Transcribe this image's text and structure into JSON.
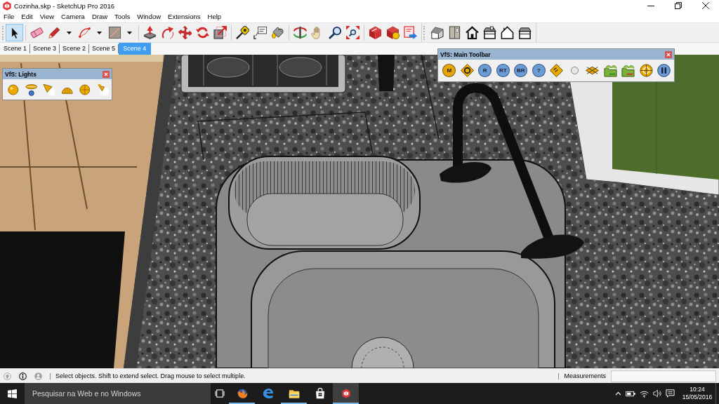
{
  "window": {
    "title": "Cozinha.skp - SketchUp Pro 2016"
  },
  "menu": [
    "File",
    "Edit",
    "View",
    "Camera",
    "Draw",
    "Tools",
    "Window",
    "Extensions",
    "Help"
  ],
  "toolbars": [
    {
      "groups": [
        [
          {
            "selected": true,
            "dropdown": false
          }
        ],
        [
          {
            "selected": false,
            "dropdown": false
          },
          {
            "selected": false,
            "dropdown": true
          },
          {
            "selected": false,
            "dropdown": true
          },
          {
            "selected": false,
            "dropdown": true
          }
        ],
        [
          {
            "selected": false,
            "dropdown": false
          },
          {
            "selected": false,
            "dropdown": false
          },
          {
            "selected": false,
            "dropdown": false
          },
          {
            "selected": false,
            "dropdown": false
          },
          {
            "selected": false,
            "dropdown": false
          }
        ],
        [
          {
            "selected": false,
            "dropdown": false
          },
          {
            "selected": false,
            "dropdown": false
          },
          {
            "selected": false,
            "dropdown": false
          }
        ],
        [
          {
            "selected": false,
            "dropdown": false
          },
          {
            "selected": false,
            "dropdown": false
          },
          {
            "selected": false,
            "dropdown": false
          },
          {
            "selected": false,
            "dropdown": false
          }
        ],
        [
          {
            "selected": false,
            "dropdown": false
          },
          {
            "selected": false,
            "dropdown": false
          },
          {
            "selected": false,
            "dropdown": false
          }
        ]
      ]
    },
    {
      "groups": [
        [
          {
            "selected": false,
            "dropdown": false
          },
          {
            "selected": false,
            "dropdown": false
          },
          {
            "selected": false,
            "dropdown": false
          },
          {
            "selected": false,
            "dropdown": false
          },
          {
            "selected": false,
            "dropdown": false
          },
          {
            "selected": false,
            "dropdown": false
          }
        ]
      ]
    }
  ],
  "scenes": [
    {
      "label": "Scene 1",
      "selected": false
    },
    {
      "label": "Scene 3",
      "selected": false
    },
    {
      "label": "Scene 2",
      "selected": false
    },
    {
      "label": "Scene 5",
      "selected": false
    },
    {
      "label": "Scene 4",
      "selected": true
    }
  ],
  "floating_toolbars": [
    {
      "title": "VfS: Lights",
      "kind": "lights",
      "buttons": [
        {
          "kind": "glyph"
        },
        {
          "kind": "glyph"
        },
        {
          "kind": "glyph"
        },
        {
          "kind": "glyph"
        },
        {
          "kind": "glyph"
        },
        {
          "kind": "glyph"
        }
      ]
    },
    {
      "title": "VfS: Main Toolbar",
      "kind": "main",
      "buttons": [
        {
          "kind": "badge",
          "label": "M",
          "color": "#e8a400"
        },
        {
          "kind": "glyph"
        },
        {
          "kind": "badge",
          "label": "R",
          "color": "#6c9cd4"
        },
        {
          "kind": "badge",
          "label": "RT",
          "color": "#6c9cd4"
        },
        {
          "kind": "badge",
          "label": "BR",
          "color": "#6c9cd4"
        },
        {
          "kind": "badge",
          "label": "?",
          "color": "#6c9cd4"
        },
        {
          "kind": "glyph"
        },
        {
          "kind": "glyph"
        },
        {
          "kind": "glyph"
        },
        {
          "kind": "glyph"
        },
        {
          "kind": "glyph"
        },
        {
          "kind": "glyph"
        },
        {
          "kind": "glyph"
        }
      ]
    }
  ],
  "status_bar": {
    "icons": [
      {
        "disabled": true
      },
      {
        "disabled": false
      },
      {
        "disabled": true
      }
    ],
    "message": "Select objects. Shift to extend select. Drag mouse to select multiple.",
    "measurements_label": "Measurements"
  },
  "taskbar": {
    "search": {
      "placeholder": "Pesquisar na Web e no Windows"
    },
    "apps": [
      {
        "running": true,
        "active": false
      },
      {
        "running": false,
        "active": false
      },
      {
        "running": true,
        "active": false
      },
      {
        "running": false,
        "active": false
      },
      {
        "running": true,
        "active": true
      }
    ],
    "time": "10:24",
    "date": "15/05/2016"
  }
}
